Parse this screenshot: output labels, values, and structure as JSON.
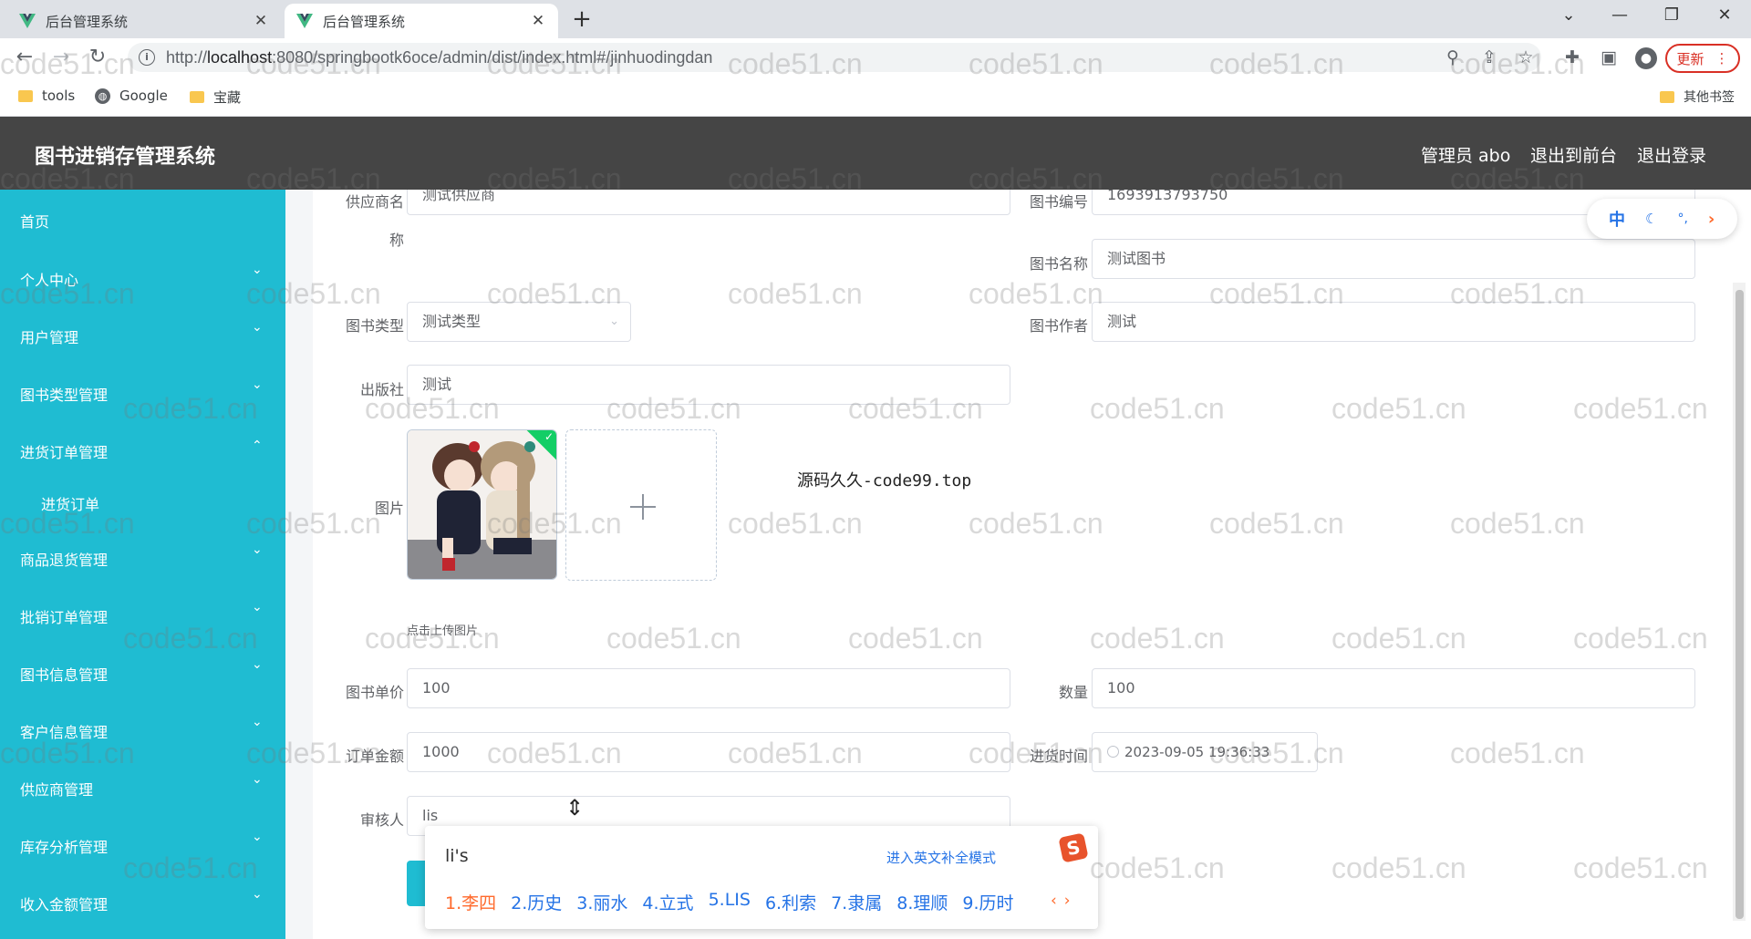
{
  "browser": {
    "tabs": [
      {
        "title": "后台管理系统",
        "active": false
      },
      {
        "title": "后台管理系统",
        "active": true
      }
    ],
    "url_prefix": "http://",
    "url_host": "localhost",
    "url_rest": ":8080/springbootk6oce/admin/dist/index.html#/jinhuodingdan",
    "update_label": "更新",
    "bookmarks": [
      "tools",
      "Google",
      "宝藏"
    ],
    "other_bookmarks": "其他书签"
  },
  "header": {
    "title": "图书进销存管理系统",
    "user": "管理员 abo",
    "back_to_front": "退出到前台",
    "logout": "退出登录"
  },
  "sidebar": {
    "items": [
      {
        "label": "首页",
        "arrow": ""
      },
      {
        "label": "个人中心",
        "arrow": "⌄"
      },
      {
        "label": "用户管理",
        "arrow": "⌄"
      },
      {
        "label": "图书类型管理",
        "arrow": "⌄"
      },
      {
        "label": "进货订单管理",
        "arrow": "⌃"
      },
      {
        "label": "进货订单",
        "arrow": ""
      },
      {
        "label": "商品退货管理",
        "arrow": "⌄"
      },
      {
        "label": "批销订单管理",
        "arrow": "⌄"
      },
      {
        "label": "图书信息管理",
        "arrow": "⌄"
      },
      {
        "label": "客户信息管理",
        "arrow": "⌄"
      },
      {
        "label": "供应商管理",
        "arrow": "⌄"
      },
      {
        "label": "库存分析管理",
        "arrow": "⌄"
      },
      {
        "label": "收入金额管理",
        "arrow": "⌄"
      }
    ]
  },
  "form": {
    "supplier_label_1": "供应商名",
    "supplier_label_2": "称",
    "supplier_value": "测试供应商",
    "book_no_label": "图书编号",
    "book_no_value": "1693913793750",
    "book_name_label": "图书名称",
    "book_name_value": "测试图书",
    "book_type_label": "图书类型",
    "book_type_value": "测试类型",
    "author_label": "图书作者",
    "author_value": "测试",
    "publisher_label": "出版社",
    "publisher_value": "测试",
    "image_label": "图片",
    "upload_tip": "点击上传图片",
    "overlay_text": "源码久久-code99.top",
    "price_label": "图书单价",
    "price_value": "100",
    "quantity_label": "数量",
    "quantity_value": "100",
    "amount_label": "订单金额",
    "amount_value": "1000",
    "time_label": "进货时间",
    "time_value": "2023-09-05 19:36:33",
    "reviewer_label": "审核人",
    "reviewer_value": "lis"
  },
  "ime": {
    "lang": "中",
    "input": "li's",
    "mode_link": "进入英文补全模式",
    "logo": "S",
    "candidates": [
      "1.李四",
      "2.历史",
      "3.丽水",
      "4.立式",
      "5.LIS",
      "6.利索",
      "7.隶属",
      "8.理顺",
      "9.历时"
    ]
  },
  "watermark": "code51.cn"
}
